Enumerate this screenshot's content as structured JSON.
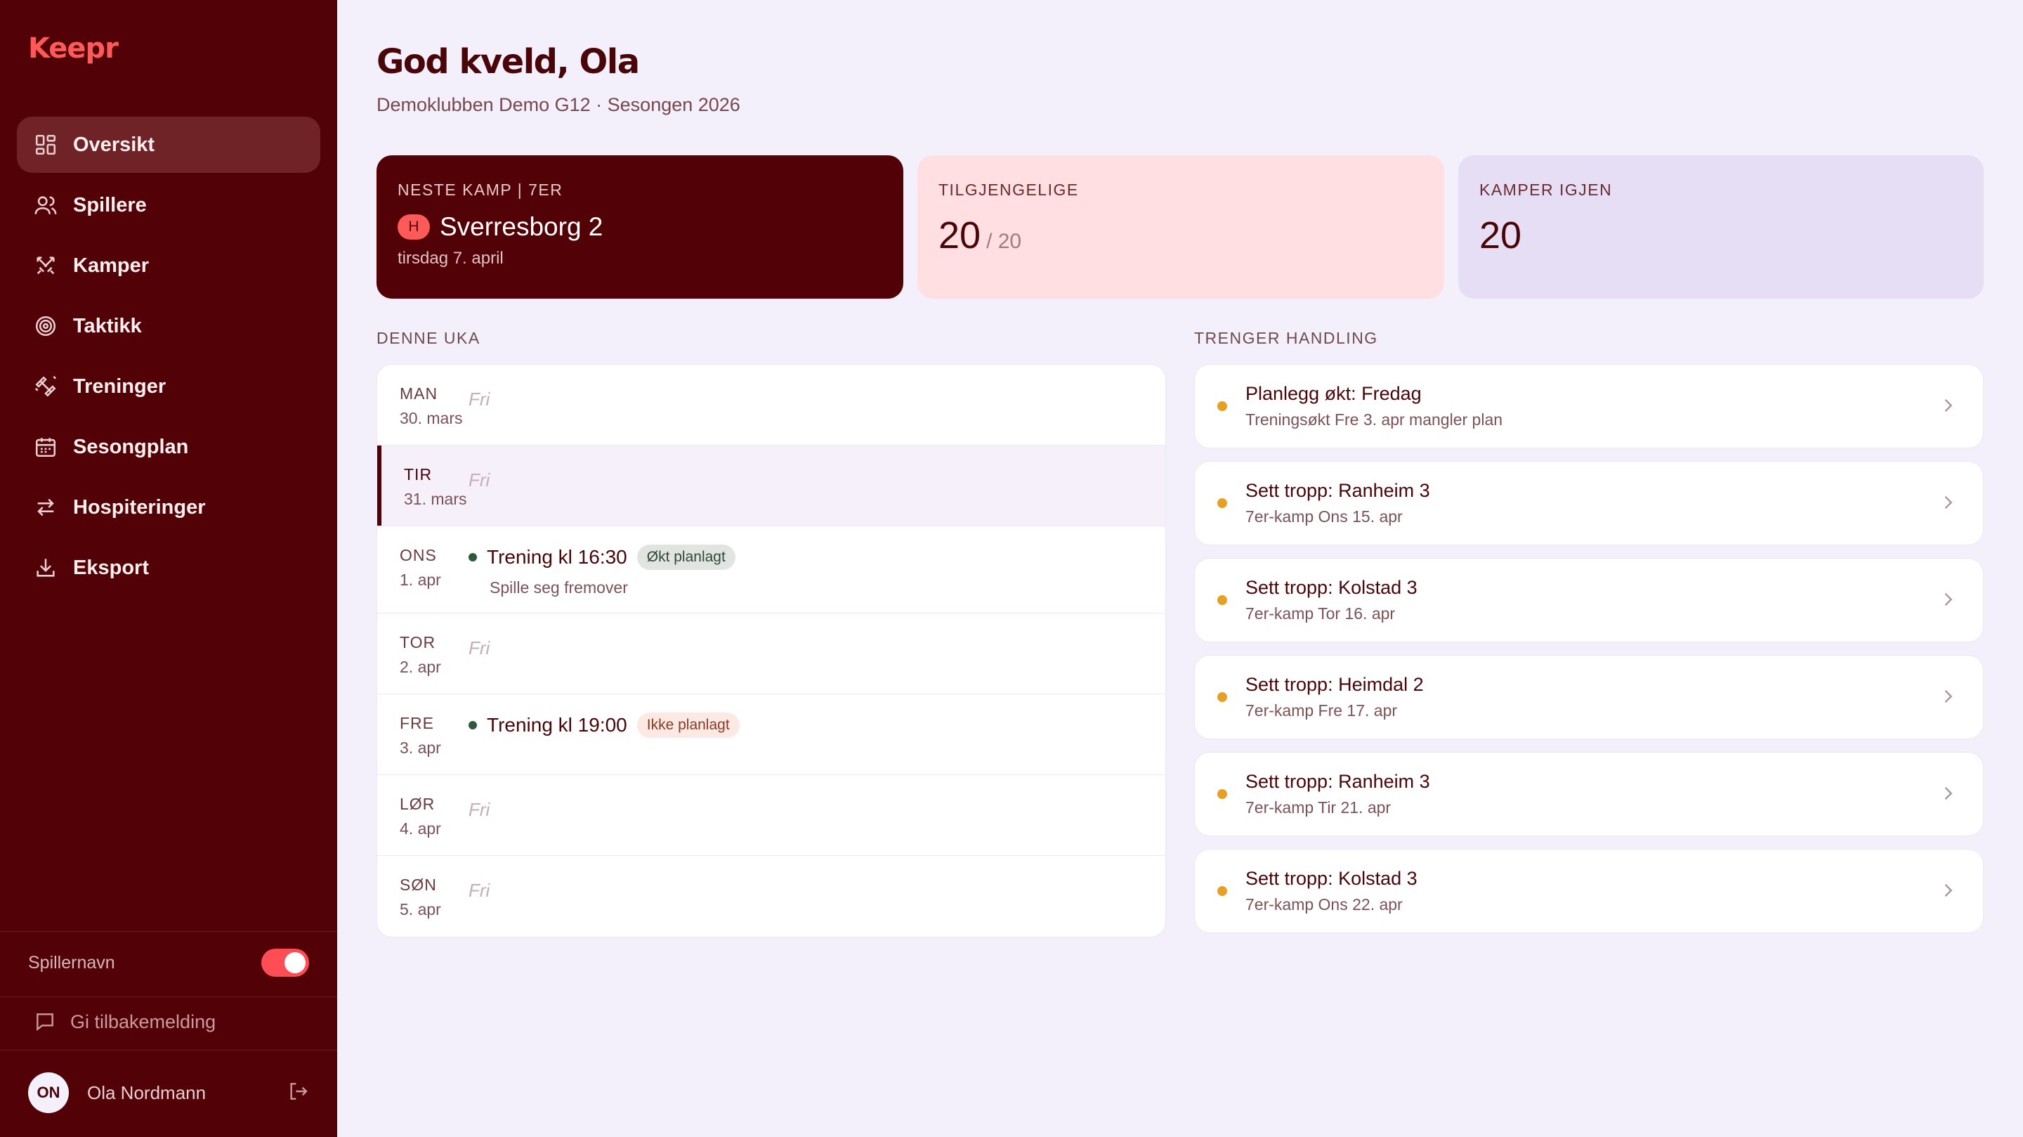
{
  "app": {
    "logo": "Keepr"
  },
  "sidebar": {
    "items": [
      {
        "label": "Oversikt",
        "icon": "dashboard-icon",
        "active": true
      },
      {
        "label": "Spillere",
        "icon": "users-icon"
      },
      {
        "label": "Kamper",
        "icon": "crossed-swords-icon"
      },
      {
        "label": "Taktikk",
        "icon": "target-icon"
      },
      {
        "label": "Treninger",
        "icon": "dumbbell-icon"
      },
      {
        "label": "Sesongplan",
        "icon": "calendar-icon"
      },
      {
        "label": "Hospiteringer",
        "icon": "swap-arrows-icon"
      },
      {
        "label": "Eksport",
        "icon": "download-icon"
      }
    ],
    "toggle_label": "Spillernavn",
    "toggle_on": true,
    "feedback_label": "Gi tilbakemelding",
    "user": {
      "initials": "ON",
      "name": "Ola Nordmann"
    }
  },
  "header": {
    "greeting": "God kveld, Ola",
    "subtitle": "Demoklubben Demo G12 · Sesongen 2026"
  },
  "cards": {
    "next_match": {
      "title": "NESTE KAMP | 7ER",
      "home_badge": "H",
      "opponent": "Sverresborg 2",
      "date": "tirsdag 7. april"
    },
    "available": {
      "title": "TILGJENGELIGE",
      "value": "20",
      "of": "/ 20"
    },
    "matches_left": {
      "title": "KAMPER IGJEN",
      "value": "20"
    }
  },
  "week": {
    "title": "DENNE UKA",
    "free_label": "Fri",
    "days": [
      {
        "name": "MAN",
        "date": "30. mars",
        "free": "Fri"
      },
      {
        "name": "TIR",
        "date": "31. mars",
        "free": "Fri",
        "today": true
      },
      {
        "name": "ONS",
        "date": "1. apr",
        "event": "Trening kl 16:30",
        "tag": "Økt planlagt",
        "sub": "Spille seg fremover"
      },
      {
        "name": "TOR",
        "date": "2. apr",
        "free": "Fri"
      },
      {
        "name": "FRE",
        "date": "3. apr",
        "event": "Trening kl 19:00",
        "tag": "Ikke planlagt"
      },
      {
        "name": "LØR",
        "date": "4. apr",
        "free": "Fri"
      },
      {
        "name": "SØN",
        "date": "5. apr",
        "free": "Fri"
      }
    ]
  },
  "actions": {
    "title": "TRENGER HANDLING",
    "items": [
      {
        "title": "Planlegg økt: Fredag",
        "sub": "Treningsøkt Fre 3. apr mangler plan"
      },
      {
        "title": "Sett tropp: Ranheim 3",
        "sub": "7er-kamp Ons 15. apr"
      },
      {
        "title": "Sett tropp: Kolstad 3",
        "sub": "7er-kamp Tor 16. apr"
      },
      {
        "title": "Sett tropp: Heimdal 2",
        "sub": "7er-kamp Fre 17. apr"
      },
      {
        "title": "Sett tropp: Ranheim 3",
        "sub": "7er-kamp Tir 21. apr"
      },
      {
        "title": "Sett tropp: Kolstad 3",
        "sub": "7er-kamp Ons 22. apr"
      }
    ]
  },
  "colors": {
    "sidebar_bg": "#520106",
    "accent": "#ff5a5a",
    "page_bg": "#f4f0fb",
    "pending_dot": "#e8a024",
    "event_dot": "#2f5a3a"
  }
}
